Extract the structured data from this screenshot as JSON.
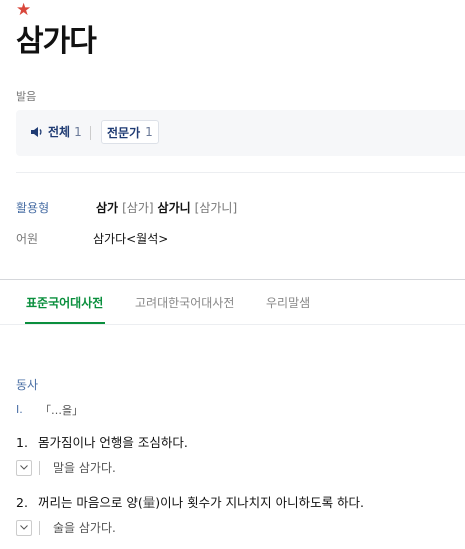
{
  "entry": {
    "star": "★",
    "headword": "삼가다"
  },
  "pronunciation": {
    "label": "발음",
    "all_label": "전체",
    "all_count": "1",
    "expert_label": "전문가",
    "expert_count": "1"
  },
  "conjugation": {
    "label": "활용형",
    "form1": "삼가",
    "form1_pron": "[삼가]",
    "form2": "삼가니",
    "form2_pron": "[삼가니]"
  },
  "etymology": {
    "label": "어원",
    "value": "삼가다<월석>"
  },
  "tabs": [
    {
      "label": "표준국어대사전",
      "active": true
    },
    {
      "label": "고려대한국어대사전",
      "active": false
    },
    {
      "label": "우리말샘",
      "active": false
    }
  ],
  "definition": {
    "pos": "동사",
    "roman": "I.",
    "pattern": "「…을」",
    "senses": [
      {
        "num": "1.",
        "text": "몸가짐이나 언행을 조심하다.",
        "example": "말을 삼가다."
      },
      {
        "num": "2.",
        "text_a": "꺼리는 마음으로 양(",
        "hanja": "量",
        "text_b": ")이나 횟수가 지나치지 아니하도록 하다.",
        "example": "술을 삼가다."
      }
    ]
  },
  "colors": {
    "accent_green": "#0a8f3d",
    "label_blue": "#4a6fa5",
    "star_red": "#d9473b"
  }
}
